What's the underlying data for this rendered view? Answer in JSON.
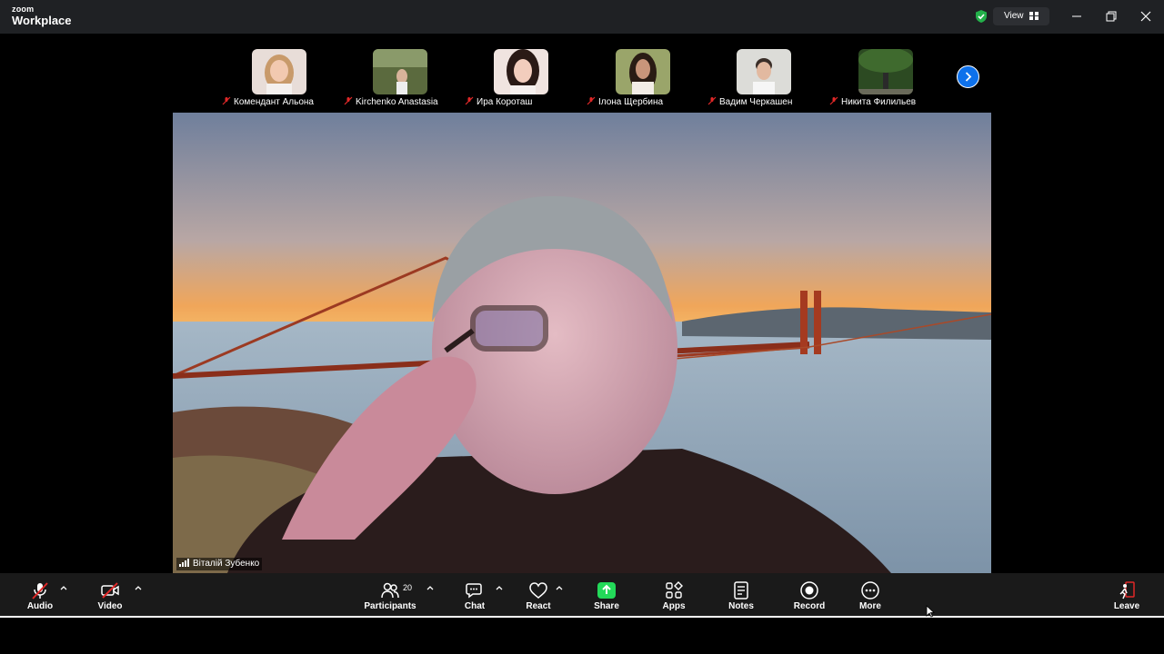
{
  "app": {
    "brand_small": "zoom",
    "brand_large": "Workplace"
  },
  "titlebar": {
    "view_label": "View"
  },
  "gallery": {
    "participants": [
      {
        "name": "Комендант Альона"
      },
      {
        "name": "Kirchenko Anastasia"
      },
      {
        "name": "Ира Короташ"
      },
      {
        "name": "Ілона Щербина"
      },
      {
        "name": "Вадим Черкашен"
      },
      {
        "name": "Никита Филильев"
      }
    ]
  },
  "speaker": {
    "name": "Віталій Зубенко"
  },
  "toolbar": {
    "audio": "Audio",
    "video": "Video",
    "participants": "Participants",
    "participants_count": "20",
    "chat": "Chat",
    "react": "React",
    "share": "Share",
    "apps": "Apps",
    "notes": "Notes",
    "record": "Record",
    "more": "More",
    "leave": "Leave"
  },
  "colors": {
    "accent": "#0e71eb",
    "share_green": "#23d959",
    "muted_red": "#e02828",
    "toolbar_bg": "#1a1a1a"
  }
}
